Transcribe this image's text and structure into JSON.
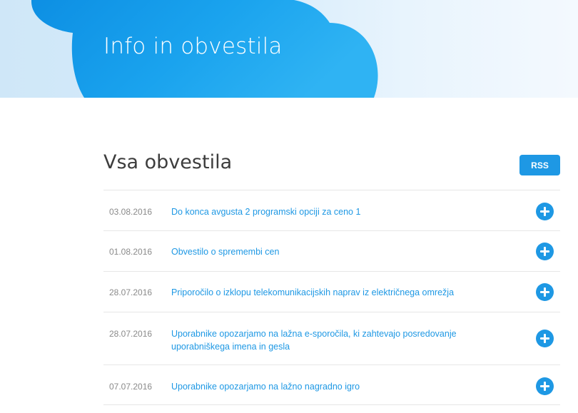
{
  "hero": {
    "title": "Info in obvestila"
  },
  "section": {
    "title": "Vsa obvestila",
    "rss_label": "RSS"
  },
  "news": [
    {
      "date": "03.08.2016",
      "title": "Do konca avgusta 2 programski opciji za ceno 1"
    },
    {
      "date": "01.08.2016",
      "title": "Obvestilo o spremembi cen"
    },
    {
      "date": "28.07.2016",
      "title": "Priporočilo o izklopu telekomunikacijskih naprav iz električnega omrežja"
    },
    {
      "date": "28.07.2016",
      "title": "Uporabnike opozarjamo na lažna e-sporočila, ki zahtevajo posredovanje uporabniškega imena in gesla"
    },
    {
      "date": "07.07.2016",
      "title": "Uporabnike opozarjamo na lažno nagradno igro"
    }
  ],
  "colors": {
    "accent": "#1e98e4",
    "cloud": "#12a1ec",
    "date": "#8a8a8a",
    "divider": "#e6e6e6"
  },
  "icons": {
    "expand": "plus-circle-icon"
  }
}
